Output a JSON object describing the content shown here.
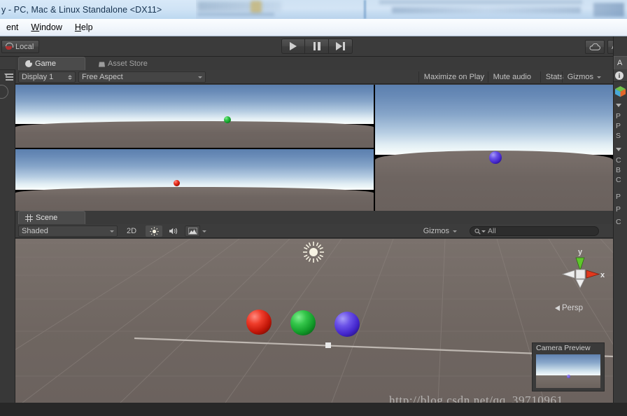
{
  "window": {
    "title": "y - PC, Mac & Linux Standalone <DX11>"
  },
  "menubar": {
    "items": [
      {
        "label": "ent",
        "accel": ""
      },
      {
        "label": "Window",
        "accel": "W"
      },
      {
        "label": "Help",
        "accel": "H"
      }
    ]
  },
  "toolbar": {
    "pivot_label": "Local",
    "play_label": "Play",
    "pause_label": "Pause",
    "step_label": "Step",
    "cloud_label": "Cloud",
    "account_label": "A"
  },
  "game_panel": {
    "tabs": [
      {
        "label": "Game",
        "icon": "game-icon",
        "active": true
      },
      {
        "label": "Asset Store",
        "icon": "asset-store-icon",
        "active": false
      }
    ],
    "display_selector": "Display 1",
    "aspect_selector": "Free Aspect",
    "maximize_on_play": "Maximize on Play",
    "mute_audio": "Mute audio",
    "stats": "Stats",
    "gizmos": "Gizmos"
  },
  "scene_panel": {
    "tabs": [
      {
        "label": "Scene",
        "icon": "scene-grid-icon",
        "active": true
      }
    ],
    "draw_mode": "Shaded",
    "two_d_toggle": "2D",
    "lighting_toggle": "lighting-icon",
    "audio_toggle": "audio-icon",
    "effects_toggle": "effects-icon",
    "gizmos": "Gizmos",
    "search_value": "All",
    "search_placeholder": "All"
  },
  "scene_view": {
    "gizmo_axis_x": "x",
    "gizmo_axis_y": "y",
    "projection_label": "Persp",
    "spheres": [
      {
        "name": "red-sphere",
        "color": "#ef3c2a"
      },
      {
        "name": "green-sphere",
        "color": "#34c54a"
      },
      {
        "name": "blue-sphere",
        "color": "#6b52e8"
      }
    ],
    "light_gizmo": "directional-light-icon"
  },
  "camera_preview": {
    "title": "Camera Preview"
  },
  "game_view": {
    "viewports": [
      {
        "name": "viewport-top-left",
        "sphere": "green-sphere"
      },
      {
        "name": "viewport-bottom-left",
        "sphere": "red-sphere"
      },
      {
        "name": "viewport-right",
        "sphere": "blue-sphere"
      }
    ]
  },
  "inspector": {
    "tab_label": "A",
    "rows": [
      "P",
      "P",
      "S",
      "C",
      "B",
      "C",
      "P",
      "P",
      "C"
    ]
  },
  "watermark": {
    "text": "http://blog.csdn.net/qq_39710961"
  },
  "colors": {
    "panel_bg": "#383838",
    "toolbar_bg": "#3b3b3b",
    "text": "#b6b6b6",
    "accent_red": "#ef3c2a",
    "accent_green": "#34c54a",
    "accent_blue": "#6b52e8"
  }
}
